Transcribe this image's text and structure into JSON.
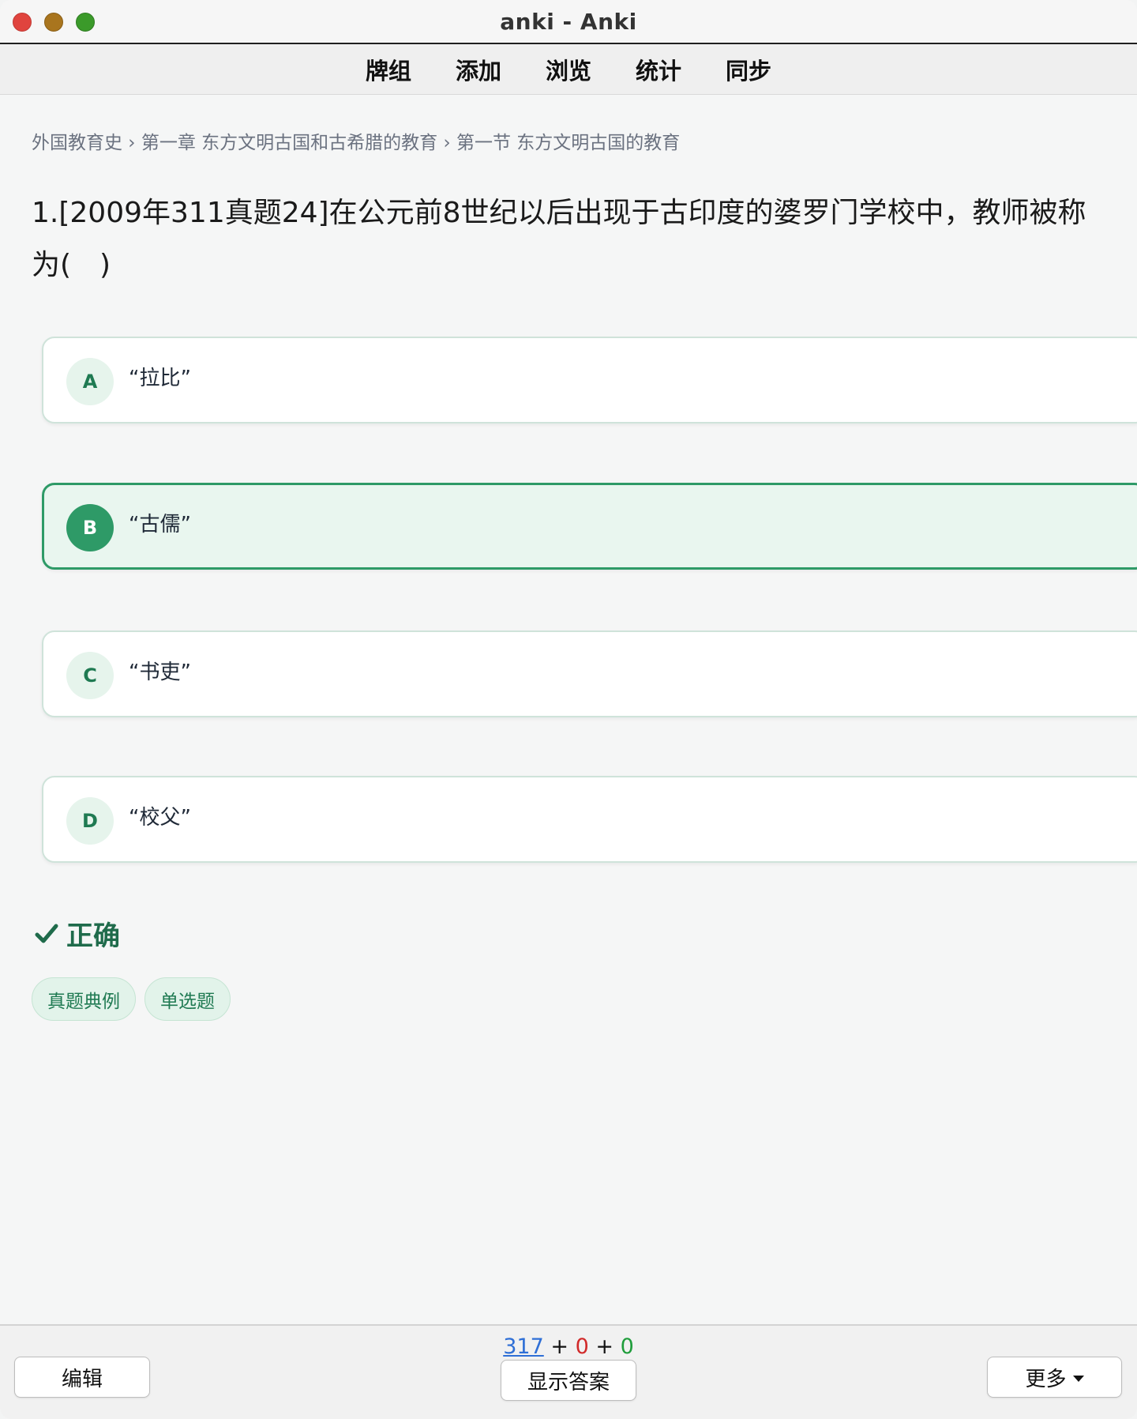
{
  "window": {
    "title": "anki - Anki"
  },
  "toolbar": {
    "items": [
      "牌组",
      "添加",
      "浏览",
      "统计",
      "同步"
    ]
  },
  "breadcrumb": "外国教育史 › 第一章 东方文明古国和古希腊的教育 › 第一节 东方文明古国的教育",
  "question": "1.[2009年311真题24]在公元前8世纪以后出现于古印度的婆罗门学校中，教师被称为(　)",
  "options": [
    {
      "key": "A",
      "text": "“拉比”",
      "selected": false
    },
    {
      "key": "B",
      "text": "“古儒”",
      "selected": true
    },
    {
      "key": "C",
      "text": "“书吏”",
      "selected": false
    },
    {
      "key": "D",
      "text": "“校父”",
      "selected": false
    }
  ],
  "result": {
    "label": "正确",
    "icon": "check-icon",
    "color": "#1f6b4b"
  },
  "tags": [
    "真题典例",
    "单选题"
  ],
  "bottom": {
    "counts": {
      "new": "317",
      "learn": "0",
      "review": "0",
      "sep": "+"
    },
    "edit_label": "编辑",
    "show_answer_label": "显示答案",
    "more_label": "更多"
  },
  "colors": {
    "accent": "#2e9a67",
    "new": "#2f6fd6",
    "learn": "#d12a2a",
    "review": "#1f9d3b"
  }
}
